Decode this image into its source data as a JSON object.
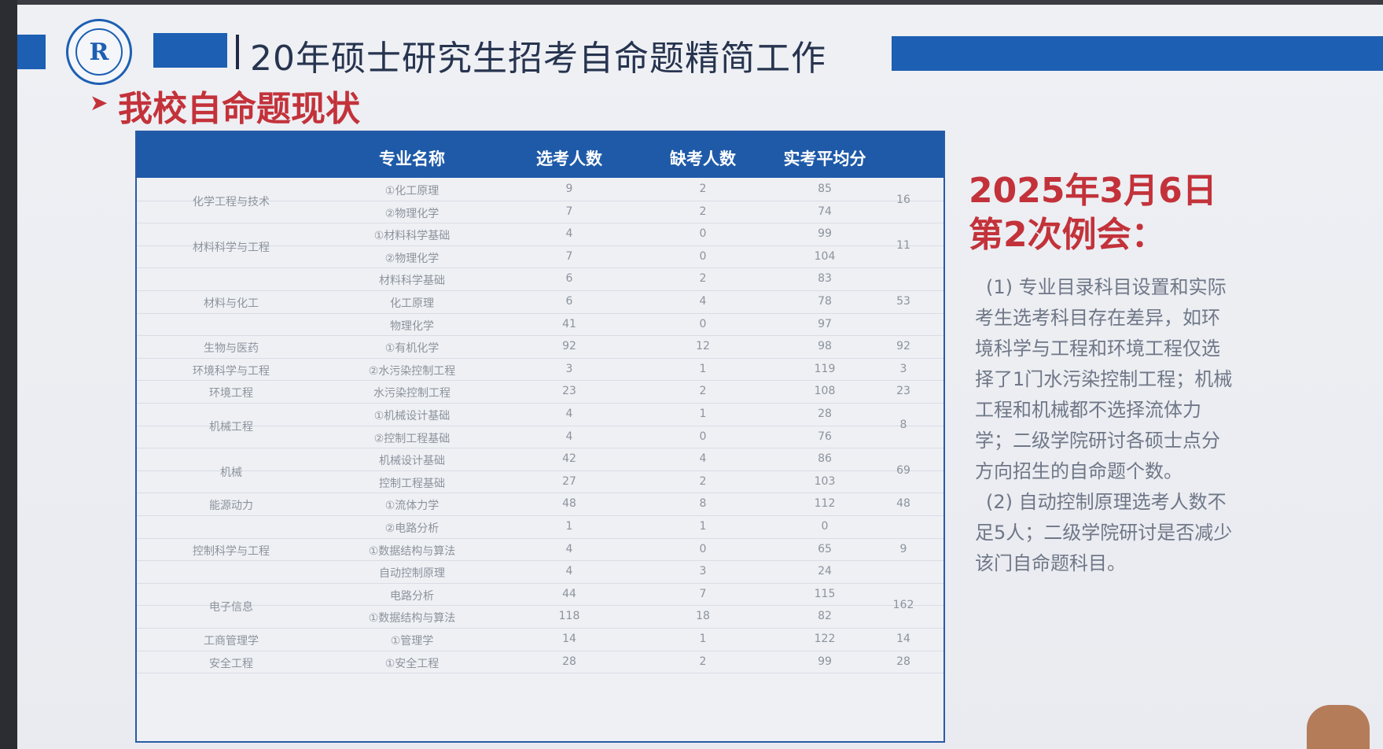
{
  "header": {
    "slide_title": "20年硕士研究生招考自命题精简工作",
    "logo_letter": "R"
  },
  "section": {
    "heading": "我校自命题现状"
  },
  "table": {
    "columns": [
      "专业名称",
      "选考人数",
      "缺考人数",
      "实考平均分"
    ],
    "groups": [
      {
        "major": "化学工程与技术",
        "total": "16",
        "rows": [
          {
            "subject": "①化工原理",
            "n": "9",
            "absent": "2",
            "avg": "85"
          },
          {
            "subject": "②物理化学",
            "n": "7",
            "absent": "2",
            "avg": "74"
          }
        ]
      },
      {
        "major": "材料科学与工程",
        "total": "11",
        "rows": [
          {
            "subject": "①材料科学基础",
            "n": "4",
            "absent": "0",
            "avg": "99"
          },
          {
            "subject": "②物理化学",
            "n": "7",
            "absent": "0",
            "avg": "104"
          }
        ]
      },
      {
        "major": "材料与化工",
        "total": "53",
        "rows": [
          {
            "subject": "材料科学基础",
            "n": "6",
            "absent": "2",
            "avg": "83"
          },
          {
            "subject": "化工原理",
            "n": "6",
            "absent": "4",
            "avg": "78"
          },
          {
            "subject": "物理化学",
            "n": "41",
            "absent": "0",
            "avg": "97"
          }
        ]
      },
      {
        "major": "生物与医药",
        "total": "92",
        "rows": [
          {
            "subject": "①有机化学",
            "n": "92",
            "absent": "12",
            "avg": "98"
          }
        ]
      },
      {
        "major": "环境科学与工程",
        "total": "3",
        "rows": [
          {
            "subject": "②水污染控制工程",
            "n": "3",
            "absent": "1",
            "avg": "119"
          }
        ]
      },
      {
        "major": "环境工程",
        "total": "23",
        "rows": [
          {
            "subject": "水污染控制工程",
            "n": "23",
            "absent": "2",
            "avg": "108"
          }
        ]
      },
      {
        "major": "机械工程",
        "total": "8",
        "rows": [
          {
            "subject": "①机械设计基础",
            "n": "4",
            "absent": "1",
            "avg": "28"
          },
          {
            "subject": "②控制工程基础",
            "n": "4",
            "absent": "0",
            "avg": "76"
          }
        ]
      },
      {
        "major": "机械",
        "total": "69",
        "rows": [
          {
            "subject": "机械设计基础",
            "n": "42",
            "absent": "4",
            "avg": "86"
          },
          {
            "subject": "控制工程基础",
            "n": "27",
            "absent": "2",
            "avg": "103"
          }
        ]
      },
      {
        "major": "能源动力",
        "total": "48",
        "rows": [
          {
            "subject": "①流体力学",
            "n": "48",
            "absent": "8",
            "avg": "112"
          }
        ]
      },
      {
        "major": "控制科学与工程",
        "total": "9",
        "rows": [
          {
            "subject": "②电路分析",
            "n": "1",
            "absent": "1",
            "avg": "0"
          },
          {
            "subject": "①数据结构与算法",
            "n": "4",
            "absent": "0",
            "avg": "65"
          },
          {
            "subject": "自动控制原理",
            "n": "4",
            "absent": "3",
            "avg": "24"
          }
        ]
      },
      {
        "major": "电子信息",
        "total": "162",
        "rows": [
          {
            "subject": "电路分析",
            "n": "44",
            "absent": "7",
            "avg": "115"
          },
          {
            "subject": "①数据结构与算法",
            "n": "118",
            "absent": "18",
            "avg": "82"
          }
        ]
      },
      {
        "major": "工商管理学",
        "total": "14",
        "rows": [
          {
            "subject": "①管理学",
            "n": "14",
            "absent": "1",
            "avg": "122"
          }
        ]
      },
      {
        "major": "安全工程",
        "total": "28",
        "rows": [
          {
            "subject": "①安全工程",
            "n": "28",
            "absent": "2",
            "avg": "99"
          }
        ]
      }
    ]
  },
  "meeting": {
    "date": "2025年3月6日",
    "title": "第2次例会：",
    "notes": [
      "(1) 专业目录科目设置和实际考生选考科目存在差异，如环境科学与工程和环境工程仅选择了1门水污染控制工程；机械工程和机械都不选择流体力学；二级学院研讨各硕士点分方向招生的自命题个数。",
      "(2) 自动控制原理选考人数不足5人；二级学院研讨是否减少该门自命题科目。"
    ]
  },
  "colors": {
    "accent_blue": "#1d5fb3",
    "accent_red": "#c3323a"
  }
}
